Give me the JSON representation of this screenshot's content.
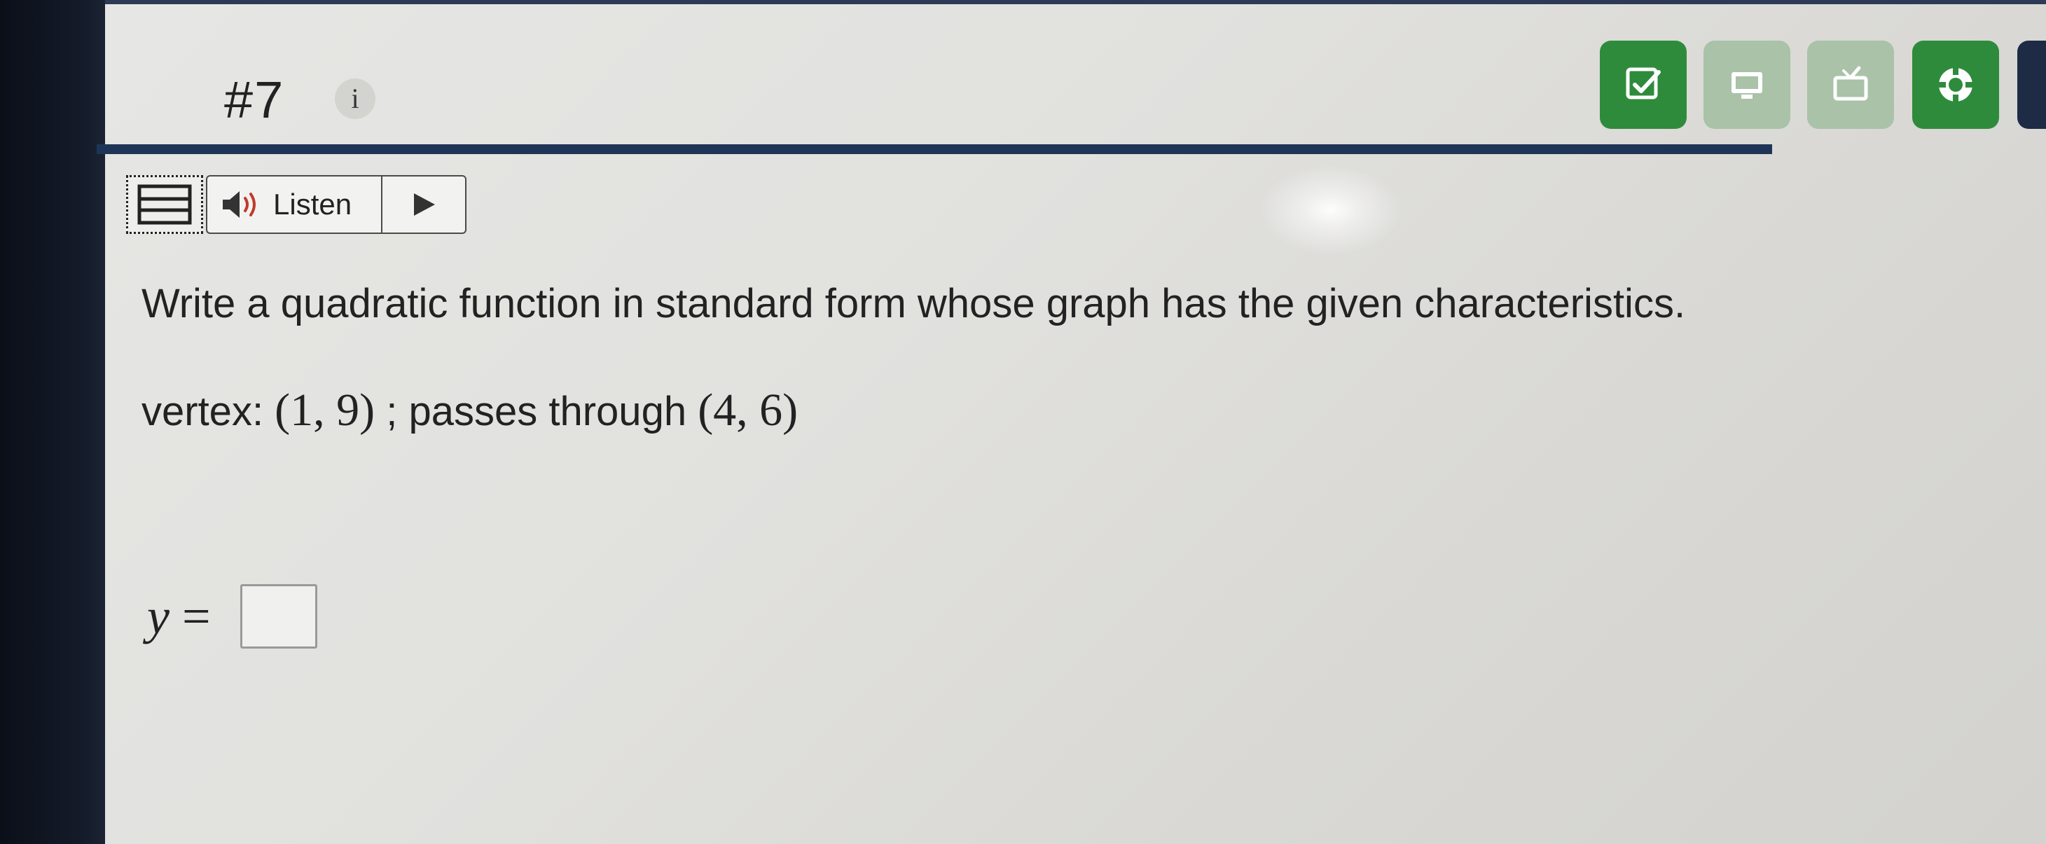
{
  "header": {
    "question_number": "#7",
    "info_label": "i"
  },
  "toolbar": {
    "buttons": [
      {
        "icon": "check-answer-icon",
        "state": "active",
        "color": "#2f8b3c"
      },
      {
        "icon": "screen-icon",
        "state": "disabled",
        "color": "#a9c2a8"
      },
      {
        "icon": "tv-icon",
        "state": "disabled",
        "color": "#a9c2a8"
      },
      {
        "icon": "help-lifebuoy-icon",
        "state": "active",
        "color": "#2f8b3c"
      }
    ]
  },
  "listen": {
    "label": "Listen",
    "icons": [
      "grid-menu-icon",
      "speaker-icon",
      "play-icon"
    ]
  },
  "question": {
    "prompt": "Write a quadratic function in standard form whose graph has the given characteristics.",
    "vertex_label": "vertex: ",
    "vertex_value": "(1, 9)",
    "separator": " ; passes through ",
    "point_value": "(4, 6)"
  },
  "answer": {
    "variable": "y",
    "equals": "=",
    "value": ""
  },
  "colors": {
    "header_rule": "#1f3557",
    "green_button": "#2f8b3c",
    "disabled_button": "#a9c2a8"
  }
}
